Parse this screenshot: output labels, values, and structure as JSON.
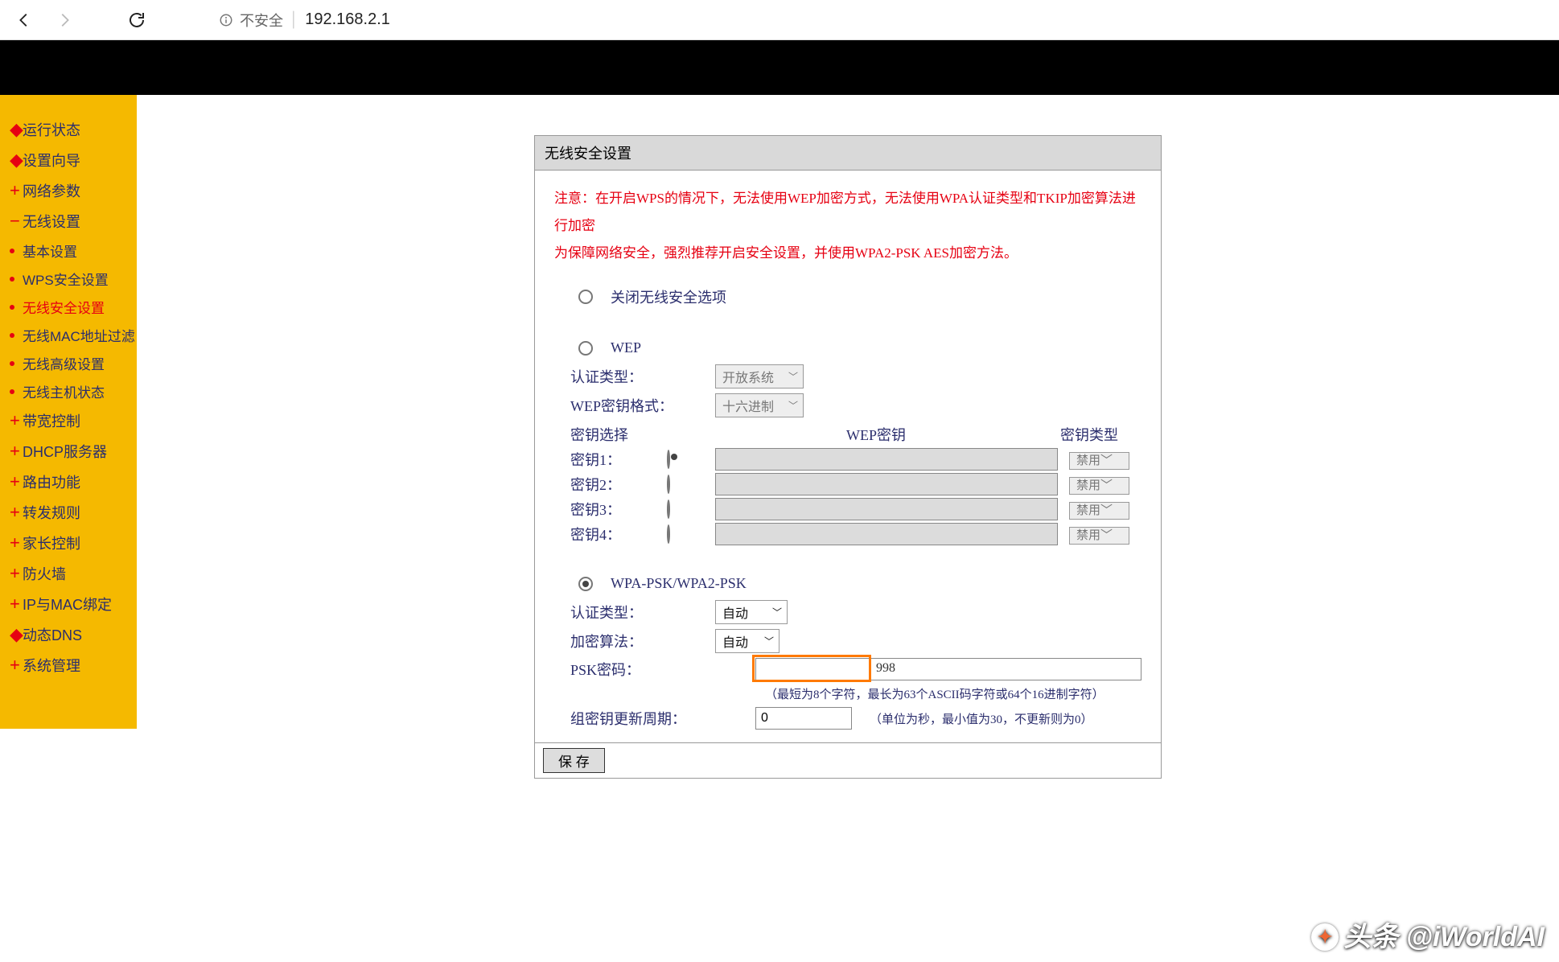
{
  "browser": {
    "security_label": "不安全",
    "url": "192.168.2.1"
  },
  "sidebar": {
    "items": [
      {
        "label": "运行状态"
      },
      {
        "label": "设置向导"
      },
      {
        "label": "网络参数"
      },
      {
        "label": "无线设置",
        "expanded": true,
        "children": [
          {
            "label": "基本设置"
          },
          {
            "label": "WPS安全设置"
          },
          {
            "label": "无线安全设置",
            "active": true
          },
          {
            "label": "无线MAC地址过滤"
          },
          {
            "label": "无线高级设置"
          },
          {
            "label": "无线主机状态"
          }
        ]
      },
      {
        "label": "带宽控制"
      },
      {
        "label": "DHCP服务器"
      },
      {
        "label": "路由功能"
      },
      {
        "label": "转发规则"
      },
      {
        "label": "家长控制"
      },
      {
        "label": "防火墙"
      },
      {
        "label": "IP与MAC绑定"
      },
      {
        "label": "动态DNS"
      },
      {
        "label": "系统管理"
      }
    ]
  },
  "panel": {
    "title": "无线安全设置",
    "notice_line1": "注意：在开启WPS的情况下，无法使用WEP加密方式，无法使用WPA认证类型和TKIP加密算法进行加密",
    "notice_line2": "为保障网络安全，强烈推荐开启安全设置，并使用WPA2-PSK AES加密方法。",
    "options": {
      "disable_label": "关闭无线安全选项",
      "wep_label": "WEP",
      "wpa_label": "WPA-PSK/WPA2-PSK",
      "selected": "wpa"
    },
    "wep": {
      "auth_label": "认证类型：",
      "auth_value": "开放系统",
      "format_label": "WEP密钥格式：",
      "format_value": "十六进制",
      "head_key_select": "密钥选择",
      "head_wep_key": "WEP密钥",
      "head_key_type": "密钥类型",
      "keys": [
        {
          "label": "密钥1：",
          "checked": true,
          "type": "禁用"
        },
        {
          "label": "密钥2：",
          "checked": false,
          "type": "禁用"
        },
        {
          "label": "密钥3：",
          "checked": false,
          "type": "禁用"
        },
        {
          "label": "密钥4：",
          "checked": false,
          "type": "禁用"
        }
      ]
    },
    "wpa": {
      "auth_label": "认证类型：",
      "auth_value": "自动",
      "cipher_label": "加密算法：",
      "cipher_value": "自动",
      "psk_label": "PSK密码：",
      "psk_value_suffix": "998",
      "psk_hint": "（最短为8个字符，最长为63个ASCII码字符或64个16进制字符）",
      "rekey_label": "组密钥更新周期：",
      "rekey_value": "0",
      "rekey_hint": "（单位为秒，最小值为30，不更新则为0）"
    },
    "save_label": "保 存"
  },
  "watermark": "头条 @iWorldAI"
}
